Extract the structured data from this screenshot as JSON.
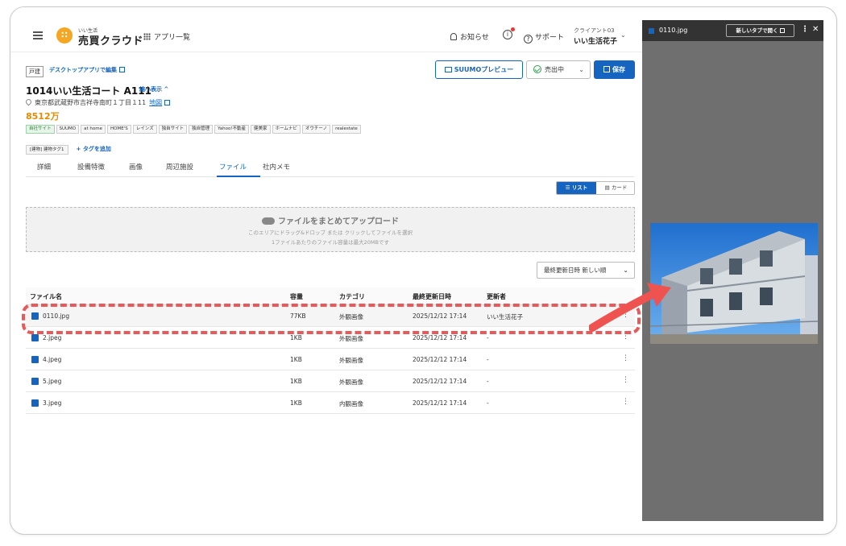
{
  "header": {
    "logo_small": "いい生活",
    "app_name": "売買クラウド",
    "apps_label": "アプリ一覧",
    "notifications_label": "お知らせ",
    "support_label": "サポート",
    "client_code": "クライアント03",
    "client_user": "いい生活花子"
  },
  "property": {
    "type_tag": "戸建",
    "edit_link": "デスクトップアプリで編集",
    "suumo_preview": "SUUMOプレビュー",
    "status": "売出中",
    "save_label": "保存",
    "title": "1014いい生活コート A111",
    "shrink_link": "縮小表示 ^",
    "address": "東京都武蔵野市吉祥寺南町１丁目１11",
    "map_link": "地図",
    "price": "8512万",
    "portals": [
      "自社サイト",
      "SUUMO",
      "at home",
      "HOME'S",
      "レインズ",
      "独自サイト",
      "独自管理",
      "Yahoo!不動産",
      "健美家",
      "ホームナビ",
      "オウチーノ",
      "realestate"
    ],
    "building_tag": "[建物] 建物タグ1",
    "add_tag": "+ タグを追加"
  },
  "tabs": [
    {
      "label": "詳細"
    },
    {
      "label": "設備特徴"
    },
    {
      "label": "画像"
    },
    {
      "label": "周辺施設"
    },
    {
      "label": "ファイル"
    },
    {
      "label": "社内メモ"
    }
  ],
  "active_tab": "ファイル",
  "view_toggle": {
    "list": "リスト",
    "card": "カード"
  },
  "upload": {
    "title": "ファイルをまとめてアップロード",
    "line1": "このエリアにドラッグ&ドロップ または クリックしてファイルを選択",
    "line2": "1ファイルあたりのファイル容量は最大20MBです"
  },
  "sort_label": "最終更新日時 新しい順",
  "table": {
    "headers": [
      "ファイル名",
      "容量",
      "カテゴリ",
      "最終更新日時",
      "更新者"
    ],
    "rows": [
      {
        "name": "0110.jpg",
        "size": "77KB",
        "category": "外観画像",
        "updated": "2025/12/12 17:14",
        "updater": "いい生活花子"
      },
      {
        "name": "2.jpeg",
        "size": "1KB",
        "category": "外観画像",
        "updated": "2025/12/12 17:14",
        "updater": "-"
      },
      {
        "name": "4.jpeg",
        "size": "1KB",
        "category": "外観画像",
        "updated": "2025/12/12 17:14",
        "updater": "-"
      },
      {
        "name": "5.jpeg",
        "size": "1KB",
        "category": "外観画像",
        "updated": "2025/12/12 17:14",
        "updater": "-"
      },
      {
        "name": "3.jpeg",
        "size": "1KB",
        "category": "内観画像",
        "updated": "2025/12/12 17:14",
        "updater": "-"
      }
    ]
  },
  "preview": {
    "file_name": "0110.jpg",
    "open_new_tab": "新しいタブで開く"
  },
  "colors": {
    "accent": "#1565c0",
    "price": "#e68a00",
    "highlight": "#e85a5a"
  }
}
